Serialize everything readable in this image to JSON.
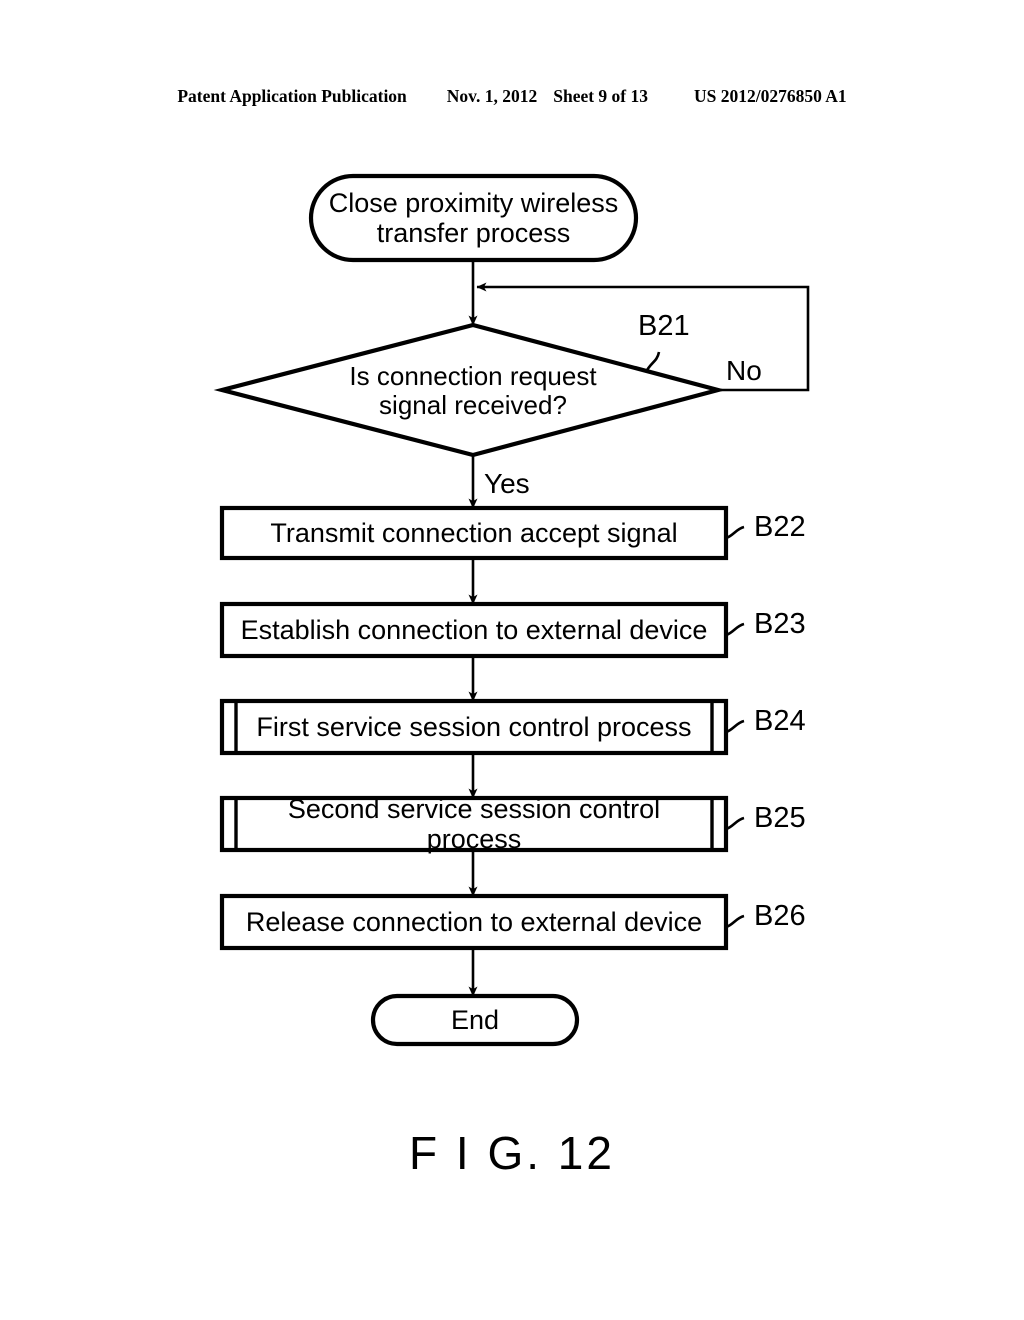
{
  "header": {
    "publication": "Patent Application Publication",
    "date": "Nov. 1, 2012",
    "sheet": "Sheet 9 of 13",
    "document_number": "US 2012/0276850 A1"
  },
  "figure": {
    "caption": "F I G. 12",
    "type": "flowchart"
  },
  "flowchart": {
    "start": {
      "id": "start",
      "shape": "terminator",
      "label": "Close proximity wireless\ntransfer process"
    },
    "decision": {
      "id": "B21",
      "shape": "decision",
      "label": "Is connection request\nsignal received?",
      "ref": "B21",
      "yes_label": "Yes",
      "no_label": "No"
    },
    "steps": [
      {
        "id": "B22",
        "shape": "process",
        "label": "Transmit connection accept signal",
        "ref": "B22"
      },
      {
        "id": "B23",
        "shape": "process",
        "label": "Establish connection to external device",
        "ref": "B23"
      },
      {
        "id": "B24",
        "shape": "subroutine",
        "label": "First service session control process",
        "ref": "B24"
      },
      {
        "id": "B25",
        "shape": "subroutine",
        "label": "Second service session control process",
        "ref": "B25"
      },
      {
        "id": "B26",
        "shape": "process",
        "label": "Release connection to external device",
        "ref": "B26"
      }
    ],
    "end": {
      "id": "end",
      "shape": "terminator",
      "label": "End"
    }
  },
  "colors": {
    "ink": "#000000",
    "paper": "#ffffff"
  }
}
